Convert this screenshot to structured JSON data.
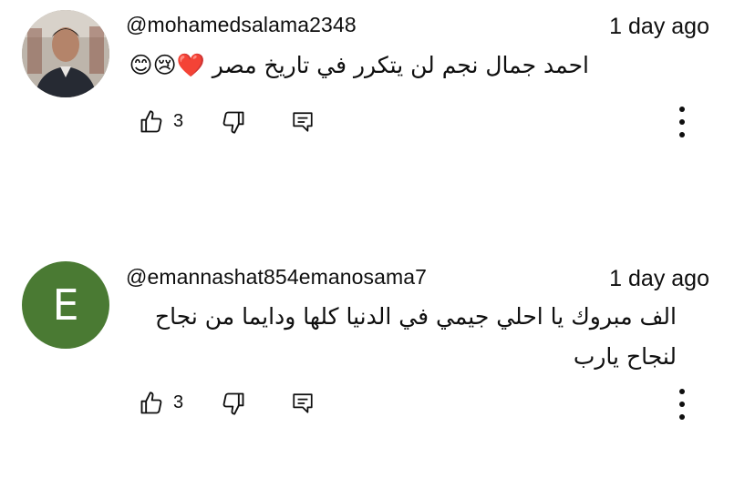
{
  "comments": [
    {
      "username": "@mohamedsalama2348",
      "time": "1 day ago",
      "avatar": {
        "type": "photo"
      },
      "text": "احمد جمال نجم لن يتكرر في تاريخ مصر ❤️😢😊",
      "likes": "3",
      "icons": {
        "like": "thumbs-up-icon",
        "dislike": "thumbs-down-icon",
        "reply": "reply-icon",
        "more": "more-vert-icon"
      }
    },
    {
      "username": "@emannashat854emanosama7",
      "time": "1 day ago",
      "avatar": {
        "type": "letter",
        "letter": "E",
        "color": "#4a7a33"
      },
      "text": "الف مبروك يا احلي جيمي في الدنيا كلها ودايما من نجاح لنجاح يارب",
      "likes": "3",
      "icons": {
        "like": "thumbs-up-icon",
        "dislike": "thumbs-down-icon",
        "reply": "reply-icon",
        "more": "more-vert-icon"
      }
    }
  ]
}
